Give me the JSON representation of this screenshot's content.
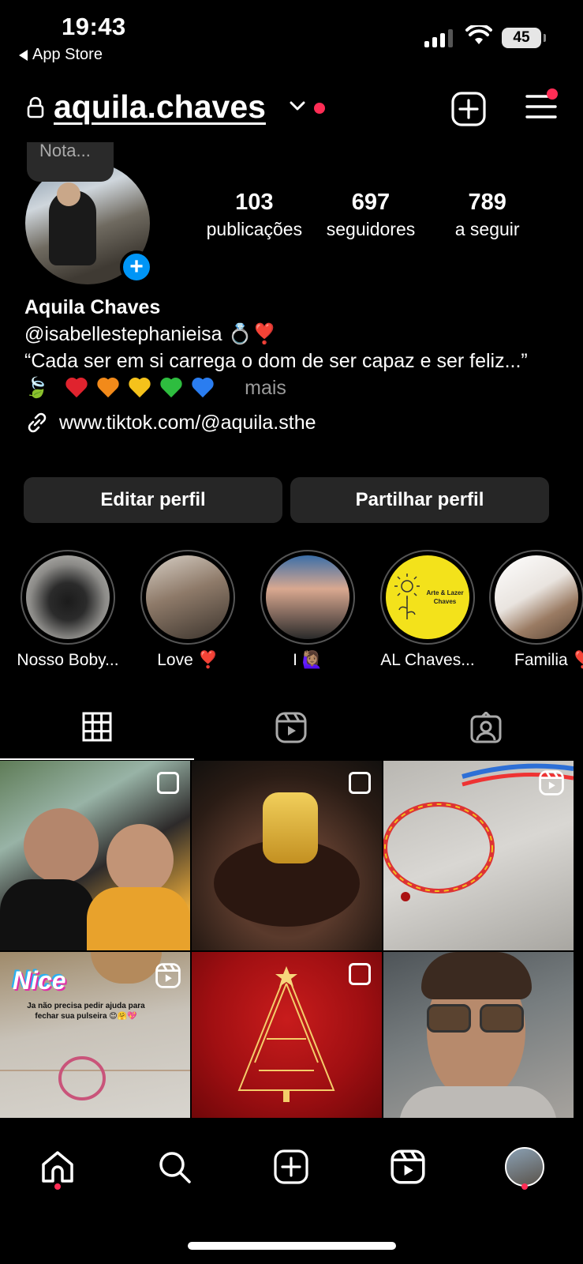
{
  "status_bar": {
    "time": "19:43",
    "back_label": "App Store",
    "battery": "45"
  },
  "header": {
    "username": "aquila.chaves"
  },
  "profile": {
    "note_placeholder": "Nota...",
    "stats": [
      {
        "value": "103",
        "label": "publicações"
      },
      {
        "value": "697",
        "label": "seguidores"
      },
      {
        "value": "789",
        "label": "a seguir"
      }
    ],
    "display_name": "Aquila Chaves",
    "bio_handle": "@isabellestephanieisa 💍❣️",
    "bio_quote": "“Cada ser em si carrega o dom de ser capaz e ser feliz...”",
    "bio_emojis": "🍃",
    "hearts": [
      "#e0232e",
      "#f28a1a",
      "#f5c21b",
      "#2ebd3f",
      "#2a7df0"
    ],
    "more_label": "mais",
    "link": "www.tiktok.com/@aquila.sthe"
  },
  "buttons": {
    "edit": "Editar perfil",
    "share": "Partilhar perfil"
  },
  "highlights": [
    {
      "label": "Nosso Boby..."
    },
    {
      "label": "Love ❣️"
    },
    {
      "label": "I 🙋🏽‍♀️"
    },
    {
      "label": "AL Chaves...",
      "inner_text": "Arte & Lazer Chaves"
    },
    {
      "label": "Familia ❣️"
    }
  ],
  "tabs": [
    {
      "icon": "grid-icon"
    },
    {
      "icon": "reels-icon"
    },
    {
      "icon": "tagged-icon"
    }
  ],
  "grid": {
    "post4_text_title": "Nice",
    "post4_text_body": "Ja não precisa pedir ajuda para fechar sua pulseira 😊🤗💖"
  },
  "bottom_nav": [
    {
      "icon": "home-icon"
    },
    {
      "icon": "search-icon"
    },
    {
      "icon": "create-icon"
    },
    {
      "icon": "reels-icon"
    },
    {
      "icon": "profile-avatar"
    }
  ],
  "colors": {
    "accent_blue": "#0095f6",
    "notification_red": "#ff2d55",
    "button_bg": "#262626"
  }
}
